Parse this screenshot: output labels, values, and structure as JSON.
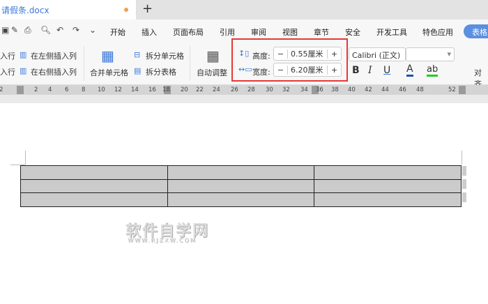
{
  "tab": {
    "title": "请假条.docx",
    "new_tab": "+"
  },
  "quick": [
    "↶",
    "↷",
    "⌄"
  ],
  "menu": [
    "开始",
    "插入",
    "页面布局",
    "引用",
    "审阅",
    "视图",
    "章节",
    "安全",
    "开发工具",
    "特色应用",
    "表格工具"
  ],
  "ribbon": {
    "insert_row_above": "入行",
    "insert_row_below": "入行",
    "insert_col_left": "在左侧插入列",
    "insert_col_right": "在右侧插入列",
    "merge": "合并单元格",
    "split_cell": "拆分单元格",
    "split_table": "拆分表格",
    "autofit": "自动调整",
    "height_label": "高度:",
    "height_value": "0.55厘米",
    "width_label": "宽度:",
    "width_value": "6.20厘米",
    "minus": "−",
    "plus": "+",
    "font": "Calibri (正文)",
    "bold": "B",
    "italic": "I",
    "underline": "U",
    "font_color": "A",
    "highlight": "ab",
    "align": "对齐"
  },
  "ruler": [
    "2",
    "2",
    "4",
    "6",
    "8",
    "10",
    "12",
    "14",
    "16",
    "18",
    "20",
    "22",
    "24",
    "26",
    "28",
    "30",
    "32",
    "34",
    "36",
    "38",
    "40",
    "42",
    "44",
    "46",
    "48",
    "52"
  ],
  "table": {
    "rows": 3,
    "cols": 3
  },
  "watermark": {
    "main": "软件自学网",
    "sub": "WWW.RJZXW.COM"
  }
}
